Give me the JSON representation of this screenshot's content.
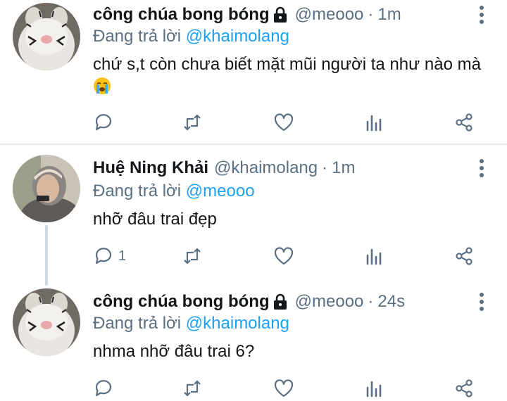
{
  "tweets": [
    {
      "name": "công chúa bong bóng",
      "handle": "@meooo",
      "time": "1m",
      "replying_prefix": "Đang trả lời ",
      "replying_to": "@khaimolang",
      "text": "chứ s,t còn chưa biết mặt mũi người ta như nào mà",
      "locked": true,
      "reply_count": ""
    },
    {
      "name": "Huệ Ning Khải",
      "handle": "@khaimolang",
      "time": "1m",
      "replying_prefix": "Đang trả lời ",
      "replying_to": "@meooo",
      "text": "nhỡ đâu trai đẹp",
      "locked": false,
      "reply_count": "1"
    },
    {
      "name": "công chúa bong bóng",
      "handle": "@meooo",
      "time": "24s",
      "replying_prefix": "Đang trả lời ",
      "replying_to": "@khaimolang",
      "text": "nhma nhỡ đâu trai 6?",
      "locked": true,
      "reply_count": ""
    }
  ],
  "separator": "·",
  "icons": [
    "reply-icon",
    "retweet-icon",
    "like-icon",
    "analytics-icon",
    "share-icon",
    "more-icon",
    "lock-icon",
    "crying-emoji-icon"
  ],
  "colors": {
    "link": "#1da1f2",
    "secondary": "#5b7083",
    "text": "#14171a"
  }
}
